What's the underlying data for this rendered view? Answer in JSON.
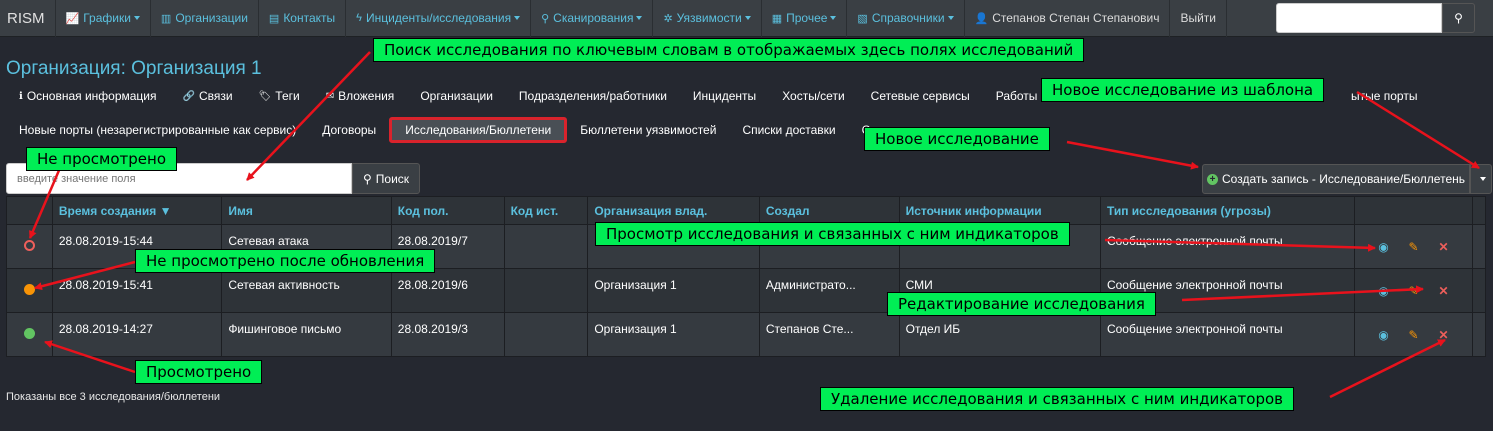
{
  "navbar": {
    "brand": "RISM",
    "items": [
      {
        "label": "Графики",
        "icon": "chart-line-icon",
        "dropdown": true
      },
      {
        "label": "Организации",
        "icon": "chart-bar-icon",
        "dropdown": false
      },
      {
        "label": "Контакты",
        "icon": "id-card-icon",
        "dropdown": false
      },
      {
        "label": "Инциденты/исследования",
        "icon": "flash-icon",
        "dropdown": true
      },
      {
        "label": "Сканирования",
        "icon": "search-icon",
        "dropdown": true
      },
      {
        "label": "Уязвимости",
        "icon": "bug-icon",
        "dropdown": true
      },
      {
        "label": "Прочее",
        "icon": "calendar-icon",
        "dropdown": true
      },
      {
        "label": "Справочники",
        "icon": "book-icon",
        "dropdown": true
      }
    ],
    "user": "Степанов Степан Степанович",
    "logout": "Выйти",
    "search_placeholder": ""
  },
  "page_title": "Организация: Организация 1",
  "tabs_row1": [
    "Основная информация",
    "Связи",
    "Теги",
    "Вложения",
    "Организации",
    "Подразделения/работники",
    "Инциденты",
    "Хосты/сети",
    "Сетевые сервисы",
    "Работы"
  ],
  "tabs_row1_tail": "ытые порты",
  "tabs_row2": [
    "Новые порты (незарегистрированные как сервис)",
    "Договоры",
    "Исследования/Бюллетени",
    "Бюллетени уязвимостей",
    "Списки доставки",
    "Со"
  ],
  "filter": {
    "placeholder": "введите значение поля",
    "button": "Поиск"
  },
  "create_button": "Создать запись - Исследование/Бюллетень",
  "table": {
    "headers": [
      "Время создания ▼",
      "Имя",
      "Код пол.",
      "Код ист.",
      "Организация влад.",
      "Создал",
      "Источник информации",
      "Тип исследования (угрозы)"
    ],
    "rows": [
      {
        "status": "new",
        "created": "28.08.2019-15:44",
        "name": "Сетевая атака",
        "code_recv": "28.08.2019/7",
        "code_src": "",
        "org": "",
        "author": "",
        "source": "",
        "type": "Сообщение электронной почты"
      },
      {
        "status": "updated",
        "created": "28.08.2019-15:41",
        "name": "Сетевая активность",
        "code_recv": "28.08.2019/6",
        "code_src": "",
        "org": "Организация 1",
        "author": "Администрато...",
        "source": "СМИ",
        "type": "Сообщение электронной почты"
      },
      {
        "status": "seen",
        "created": "28.08.2019-14:27",
        "name": "Фишинговое письмо",
        "code_recv": "28.08.2019/3",
        "code_src": "",
        "org": "Организация 1",
        "author": "Степанов Сте...",
        "source": "Отдел ИБ",
        "type": "Сообщение электронной почты"
      }
    ]
  },
  "summary": {
    "prefix": "Показаны ",
    "bold": "все 3",
    "suffix": " исследования/бюллетени"
  },
  "annotations": {
    "search": "Поиск исследования по ключевым словам в отображаемых здесь полях исследований",
    "template": "Новое исследование из шаблона",
    "new": "Новое исследование",
    "not_viewed": "Не просмотрено",
    "view": "Просмотр исследования и связанных с ним индикаторов",
    "not_viewed_updated": "Не просмотрено после обновления",
    "edit": "Редактирование исследования",
    "viewed": "Просмотрено",
    "delete": "Удаление исследования и связанных с ним индикаторов"
  },
  "colors": {
    "accent": "#5bc0de",
    "annotation_bg": "#00ee55",
    "arrow": "#e8121c",
    "active_tab_border": "#d9232c"
  }
}
